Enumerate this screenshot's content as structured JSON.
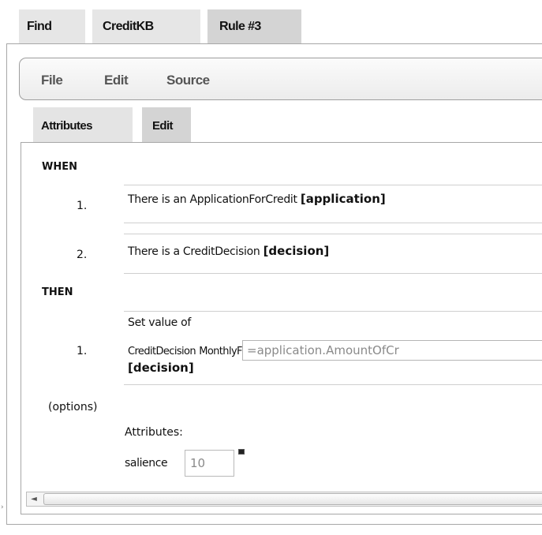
{
  "top_tabs": [
    "Find",
    "CreditKB",
    "Rule #3"
  ],
  "menu": [
    "File",
    "Edit",
    "Source"
  ],
  "sub_tabs": [
    "Attributes",
    "Edit"
  ],
  "when": {
    "label": "WHEN",
    "rows": [
      {
        "num": "1.",
        "text": "There is an ApplicationForCredit",
        "var": "[application]"
      },
      {
        "num": "2.",
        "text": "There is a CreditDecision",
        "var": "[decision]"
      }
    ]
  },
  "then": {
    "label": "THEN",
    "rows": [
      {
        "num": "1.",
        "line1": "Set value of",
        "fact": "CreditDecision",
        "field": "MonthlyFee",
        "value": "=application.AmountOfCr",
        "var": "[decision]"
      }
    ]
  },
  "options": {
    "label": "(options)",
    "attributes_label": "Attributes:",
    "salience_label": "salience",
    "salience_value": "10"
  },
  "scrollbar": {
    "left_arrow": "◄"
  },
  "side_marker": "›"
}
